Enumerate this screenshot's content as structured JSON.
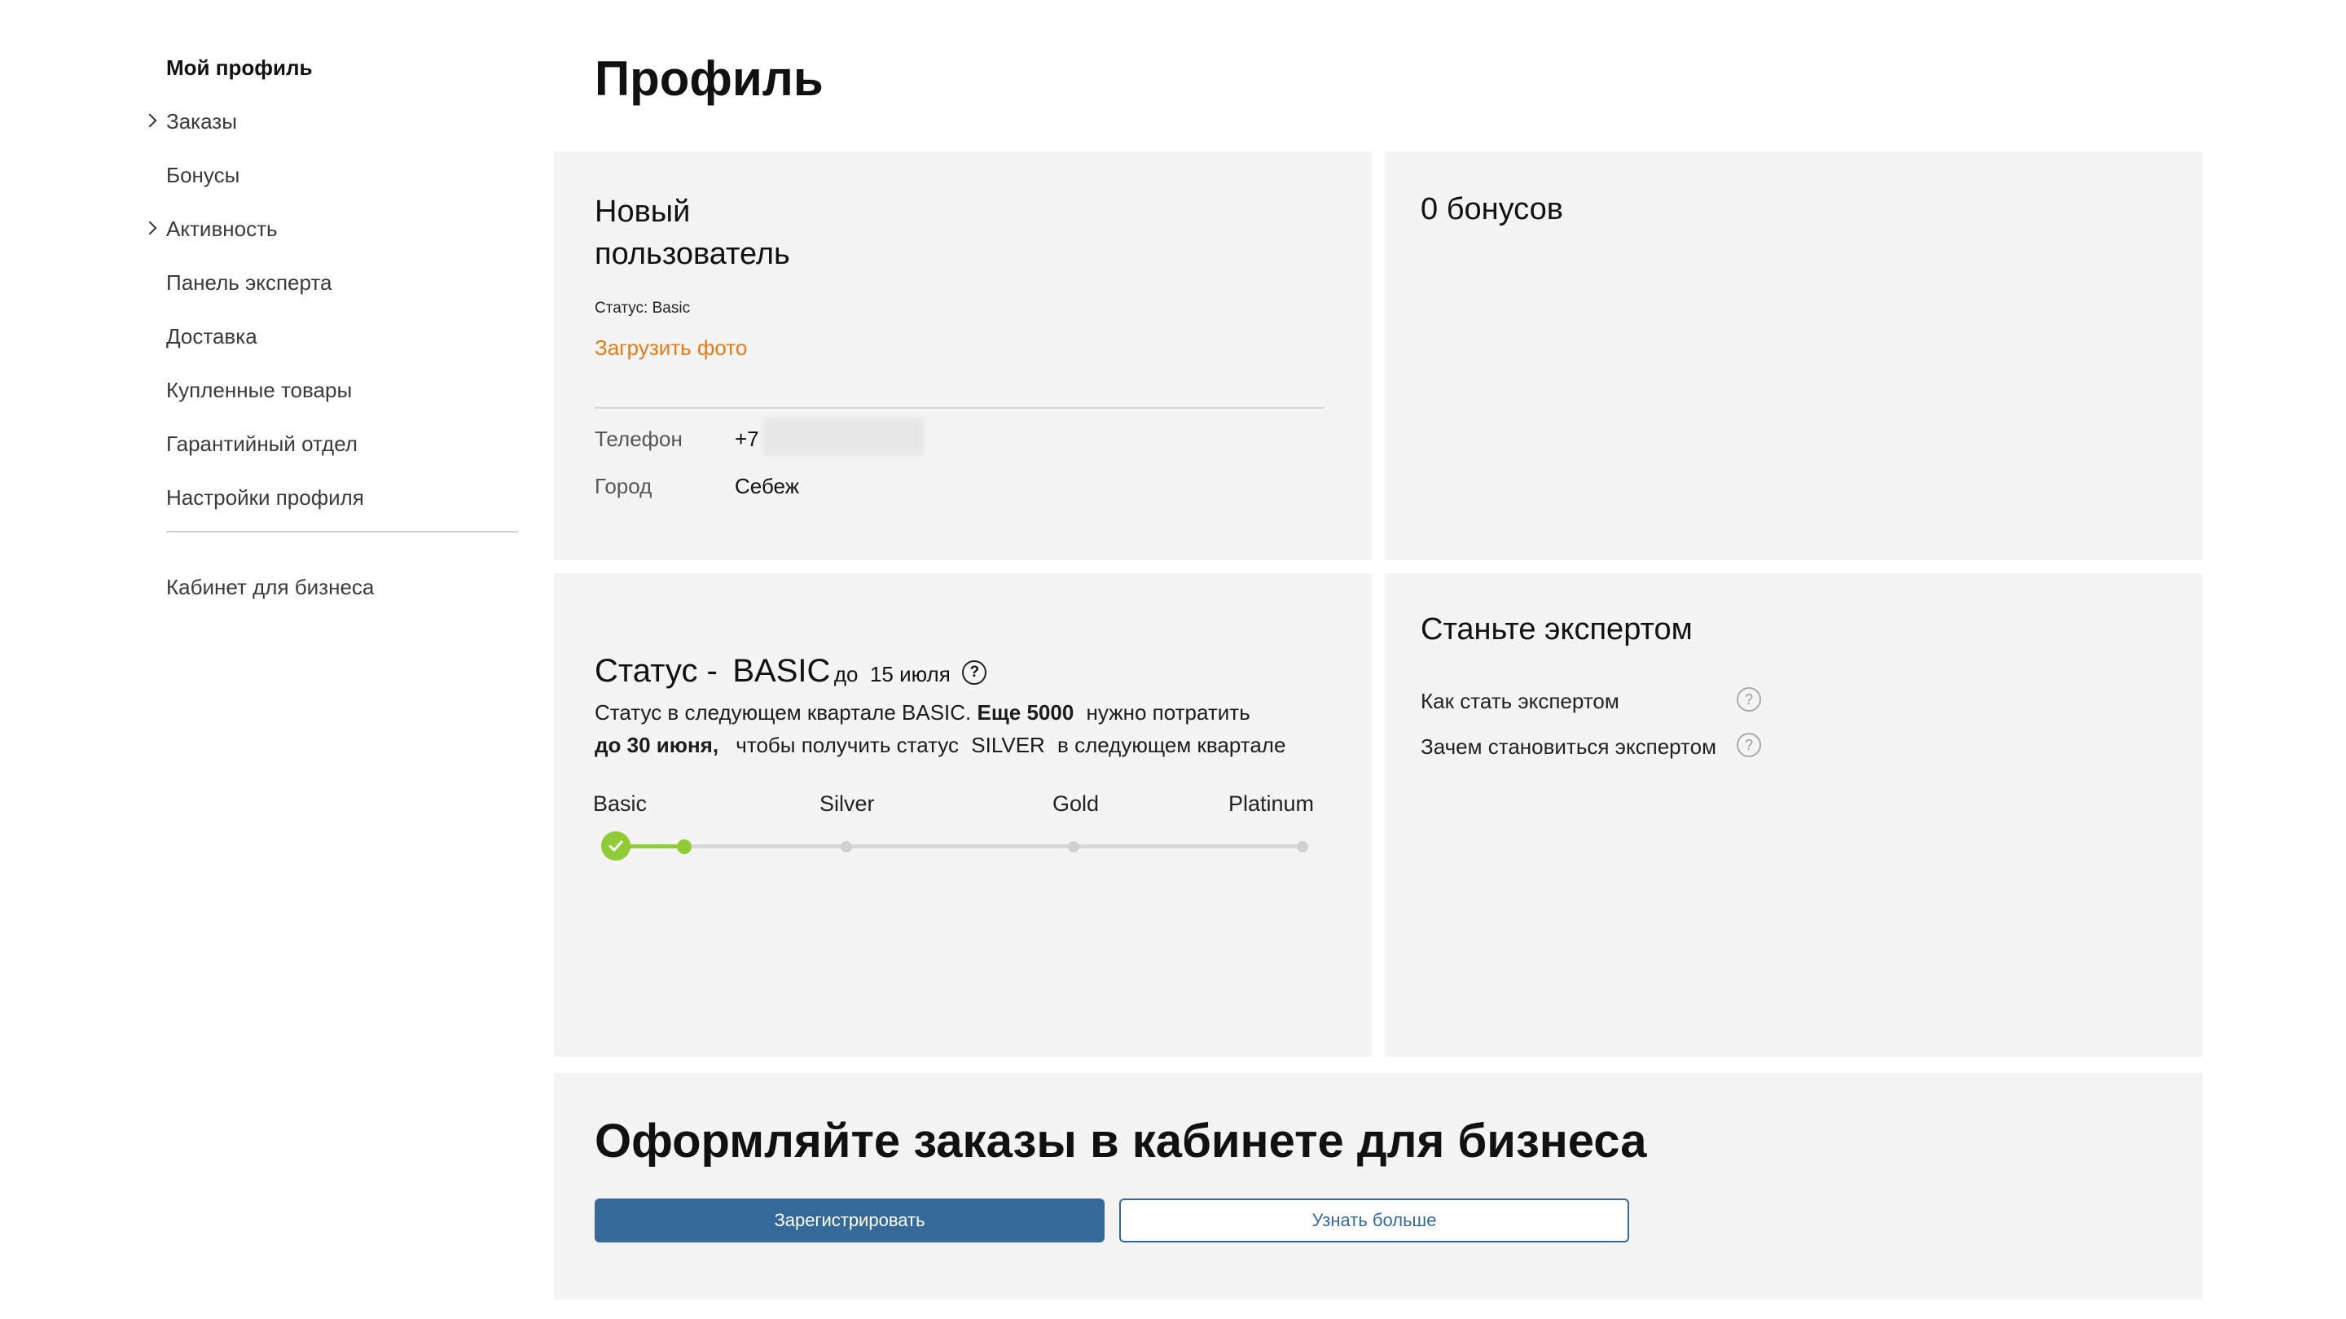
{
  "sidebar": {
    "items": [
      {
        "label": "Мой профиль",
        "active": true,
        "expandable": false
      },
      {
        "label": "Заказы",
        "active": false,
        "expandable": true
      },
      {
        "label": "Бонусы",
        "active": false,
        "expandable": false
      },
      {
        "label": "Активность",
        "active": false,
        "expandable": true
      },
      {
        "label": "Панель эксперта",
        "active": false,
        "expandable": false
      },
      {
        "label": "Доставка",
        "active": false,
        "expandable": false
      },
      {
        "label": "Купленные товары",
        "active": false,
        "expandable": false
      },
      {
        "label": "Гарантийный отдел",
        "active": false,
        "expandable": false
      },
      {
        "label": "Настройки профиля",
        "active": false,
        "expandable": false
      }
    ],
    "business_link": "Кабинет для бизнеса"
  },
  "page": {
    "title": "Профиль"
  },
  "profile_card": {
    "name_line1": "Новый",
    "name_line2": "пользователь",
    "status_text": "Статус: Basic",
    "upload_photo": "Загрузить фото",
    "phone_label": "Телефон",
    "phone_value": "+7",
    "city_label": "Город",
    "city_value": "Себеж"
  },
  "bonus_card": {
    "title": "0 бонусов"
  },
  "status_card": {
    "heading_prefix": "Статус -",
    "heading_level": "BASIC",
    "heading_until": "до",
    "heading_date": "15 июля",
    "help_icon": "help-circle-icon",
    "line1_text": "Статус в следующем квартале BASIC.",
    "line1_bold": "Еще 5000",
    "line1_tail": "нужно потратить",
    "line2_bold": "до 30 июня,",
    "line2_text": "чтобы получить статус",
    "line2_level": "SILVER",
    "line2_tail": "в следующем квартале",
    "tiers": [
      "Basic",
      "Silver",
      "Gold",
      "Platinum"
    ],
    "progress_fraction": 0.1,
    "accent_color": "#8fcb35"
  },
  "expert_card": {
    "title": "Станьте экспертом",
    "links": [
      "Как стать экспертом",
      "Зачем становиться экспертом"
    ]
  },
  "business_banner": {
    "title": "Оформляйте заказы в кабинете для бизнеса",
    "register_label": "Зарегистрировать",
    "learn_more_label": "Узнать больше",
    "button_color": "#34699a"
  },
  "colors": {
    "link_orange": "#e37b16",
    "card_bg": "#f4f4f4"
  }
}
